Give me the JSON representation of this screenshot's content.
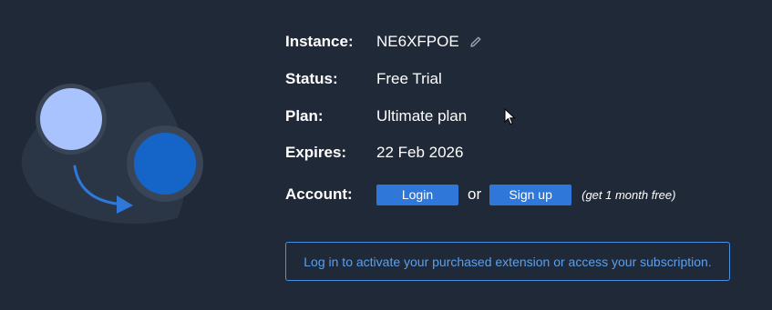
{
  "instance": {
    "label": "Instance:",
    "value": "NE6XFPOE",
    "edit_icon": "pencil-icon"
  },
  "status": {
    "label": "Status:",
    "value": "Free Trial"
  },
  "plan": {
    "label": "Plan:",
    "value": "Ultimate plan"
  },
  "expires": {
    "label": "Expires:",
    "value": "22 Feb 2026"
  },
  "account": {
    "label": "Account:",
    "login_label": "Login",
    "or_text": "or",
    "signup_label": "Sign up",
    "free_note": "(get 1 month free)"
  },
  "notice": {
    "text": "Log in to activate your purchased extension or access your subscription."
  },
  "illustration": {
    "icon": "switch-user-illustration"
  },
  "colors": {
    "background": "#1f2937",
    "accent": "#2f78d9",
    "notice_text": "#5aa0f0",
    "circle_light": "#a9c3ff",
    "circle_dark": "#1565c8"
  }
}
